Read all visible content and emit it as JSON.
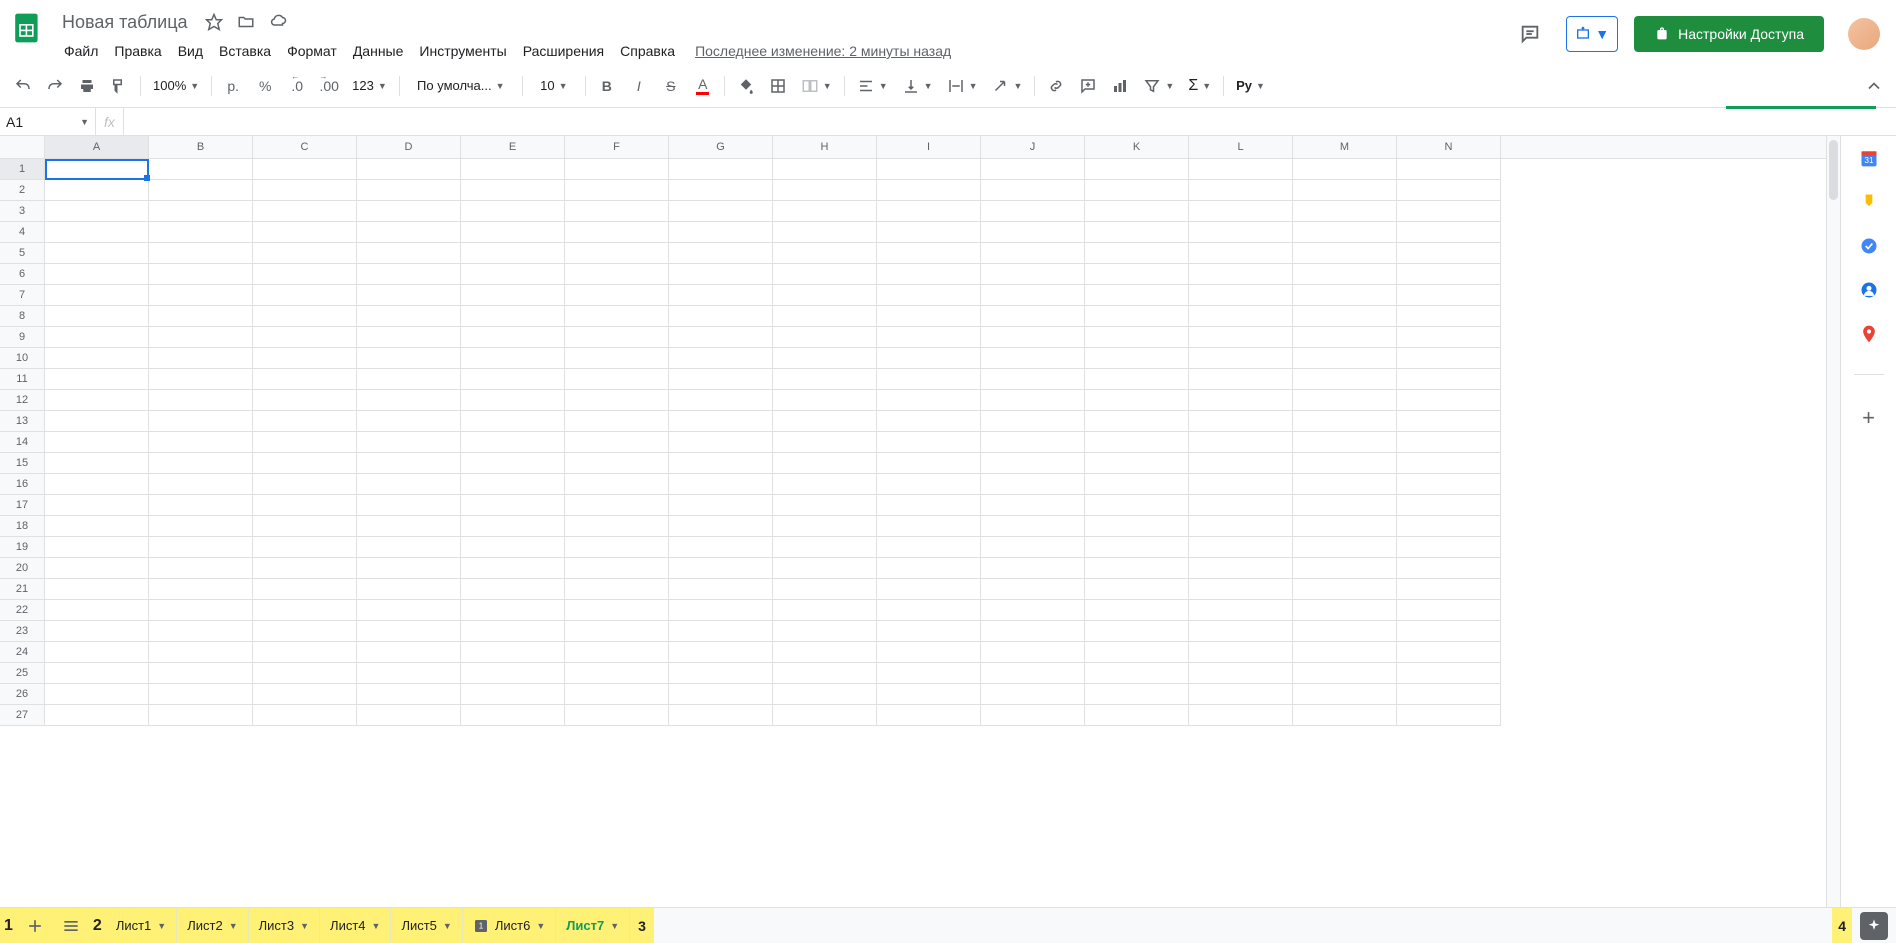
{
  "header": {
    "doc_title": "Новая таблица",
    "menu": [
      "Файл",
      "Правка",
      "Вид",
      "Вставка",
      "Формат",
      "Данные",
      "Инструменты",
      "Расширения",
      "Справка"
    ],
    "last_change": "Последнее изменение: 2 минуты назад",
    "share_label": "Настройки Доступа"
  },
  "toolbar": {
    "zoom": "100%",
    "currency": "р.",
    "percent": "%",
    "dec_dec": ".0",
    "dec_inc": ".00",
    "num_fmt": "123",
    "font": "По умолча...",
    "font_size": "10",
    "text_color_underline": "#ff0000",
    "script_label": "Рy"
  },
  "namebox": {
    "cell_ref": "A1",
    "fx": "fx"
  },
  "grid": {
    "columns": [
      "A",
      "B",
      "C",
      "D",
      "E",
      "F",
      "G",
      "H",
      "I",
      "J",
      "K",
      "L",
      "M",
      "N"
    ],
    "rows": 27,
    "selected_col": "A",
    "selected_row": 1
  },
  "sheets": {
    "tabs": [
      {
        "name": "Лист1",
        "active": false
      },
      {
        "name": "Лист2",
        "active": false
      },
      {
        "name": "Лист3",
        "active": false
      },
      {
        "name": "Лист4",
        "active": false
      },
      {
        "name": "Лист5",
        "active": false
      },
      {
        "name": "Лист6",
        "active": false,
        "icon": true
      },
      {
        "name": "Лист7",
        "active": true
      }
    ],
    "annotations": {
      "add": "1",
      "list": "2",
      "after_tabs": "3",
      "explore": "4"
    }
  }
}
